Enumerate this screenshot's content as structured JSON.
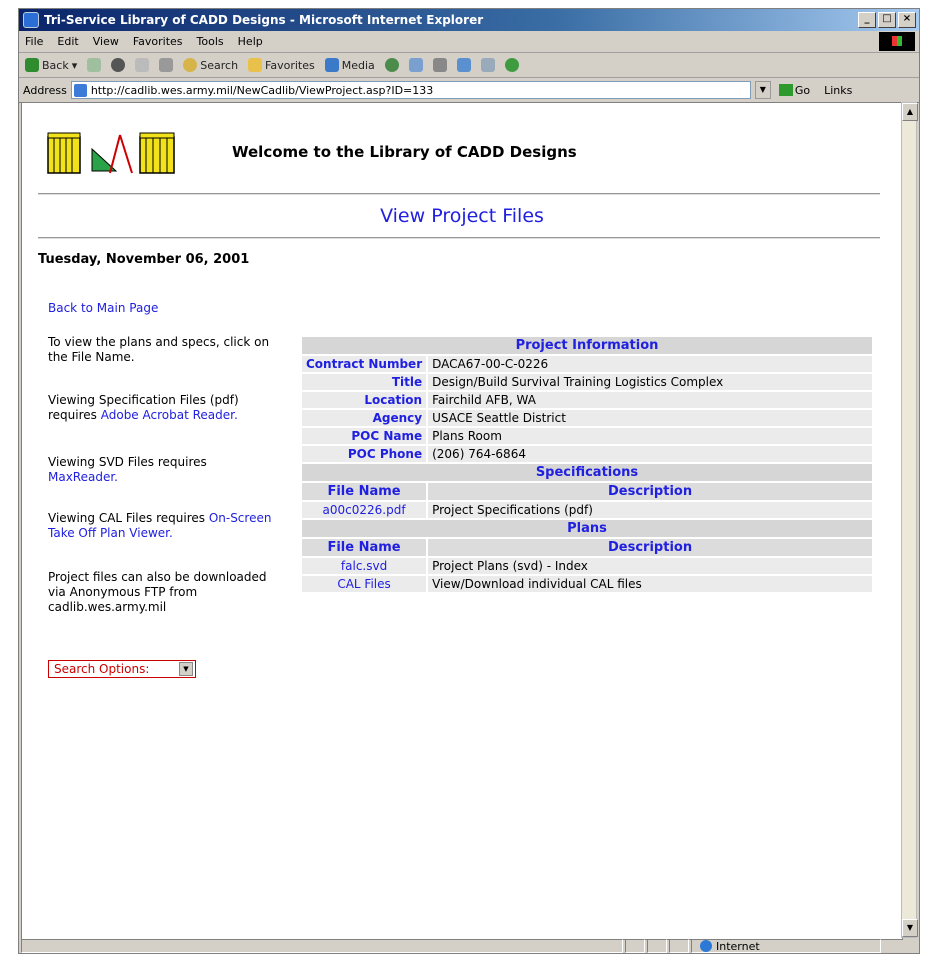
{
  "browser": {
    "title": "Tri-Service Library of CADD Designs - Microsoft Internet Explorer",
    "menu": [
      "File",
      "Edit",
      "View",
      "Favorites",
      "Tools",
      "Help"
    ],
    "toolbar": {
      "back": "Back",
      "search": "Search",
      "favorites": "Favorites",
      "media": "Media"
    },
    "address_label": "Address",
    "url": "http://cadlib.wes.army.mil/NewCadlib/ViewProject.asp?ID=133",
    "go": "Go",
    "links": "Links",
    "status_zone": "Internet"
  },
  "page": {
    "welcome": "Welcome to the Library of CADD Designs",
    "title": "View Project Files",
    "date": "Tuesday, November 06, 2001",
    "back_link": "Back to Main Page",
    "sidebar": {
      "p1": "To view the plans and specs, click on the File Name.",
      "p2_text": "Viewing Specification Files (pdf) requires ",
      "p2_link": "Adobe Acrobat Reader.",
      "p3_text": "Viewing SVD Files requires ",
      "p3_link": "MaxReader.",
      "p4_text": "Viewing CAL Files requires ",
      "p4_link": "On-Screen Take Off Plan Viewer.",
      "p5": "Project files can also be downloaded via Anonymous FTP from cadlib.wes.army.mil",
      "search_select": "Search Options:"
    }
  },
  "project": {
    "header": "Project Information",
    "contract_label": "Contract Number",
    "contract": "DACA67-00-C-0226",
    "title_label": "Title",
    "title": "Design/Build Survival Training Logistics Complex",
    "location_label": "Location",
    "location": "Fairchild AFB, WA",
    "agency_label": "Agency",
    "agency": "USACE Seattle District",
    "poc_name_label": "POC Name",
    "poc_name": "Plans Room",
    "poc_phone_label": "POC Phone",
    "poc_phone": "(206) 764-6864"
  },
  "specs": {
    "header": "Specifications",
    "col_file": "File Name",
    "col_desc": "Description",
    "rows": [
      {
        "file": "a00c0226.pdf",
        "desc": "Project Specifications (pdf)"
      }
    ]
  },
  "plans": {
    "header": "Plans",
    "col_file": "File Name",
    "col_desc": "Description",
    "rows": [
      {
        "file": "falc.svd",
        "desc": "Project Plans (svd) - Index"
      },
      {
        "file": "CAL Files",
        "desc": "View/Download individual CAL files"
      }
    ]
  }
}
